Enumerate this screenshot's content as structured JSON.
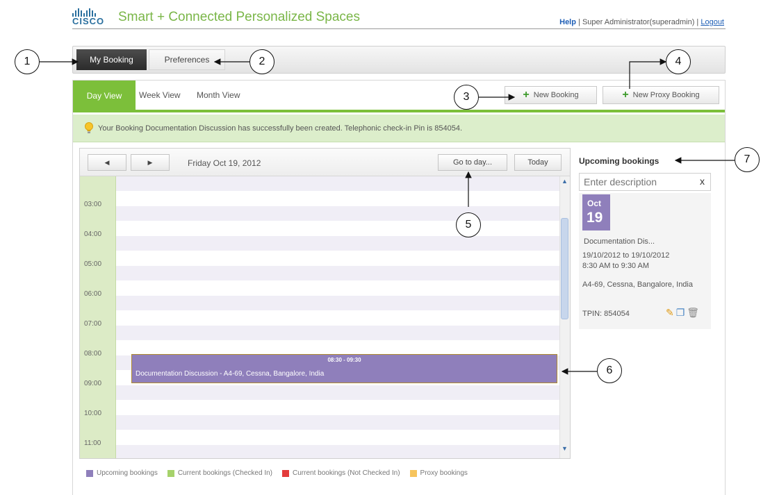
{
  "header": {
    "logo_text": "CISCO",
    "app_title": "Smart + Connected Personalized Spaces",
    "help": "Help",
    "separator": " | ",
    "user": "Super Administrator(superadmin)",
    "separator2": " | ",
    "logout": "Logout"
  },
  "top_tabs": {
    "my_booking": "My Booking",
    "preferences": "Preferences"
  },
  "view_tabs": {
    "day": "Day View",
    "week": "Week View",
    "month": "Month View"
  },
  "actions": {
    "new_booking": "New Booking",
    "new_proxy_booking": "New Proxy Booking"
  },
  "notice": "Your Booking Documentation Discussion has successfully been created. Telephonic check-in Pin is 854054.",
  "calendar": {
    "prev": "◀",
    "next": "▶",
    "date_label": "Friday Oct 19, 2012",
    "goto_day": "Go to day...",
    "today": "Today",
    "hours": [
      "03:00",
      "04:00",
      "05:00",
      "06:00",
      "07:00",
      "08:00",
      "09:00",
      "10:00",
      "11:00"
    ],
    "event": {
      "time": "08:30 - 09:30",
      "title": "Documentation Discussion - A4-69, Cessna, Bangalore, India",
      "color": "#8f7fbb"
    }
  },
  "legend": [
    {
      "label": "Upcoming bookings",
      "color": "#8f7fbb"
    },
    {
      "label": "Current bookings (Checked In)",
      "color": "#a6d26b"
    },
    {
      "label": "Current bookings (Not Checked In)",
      "color": "#e33b3b"
    },
    {
      "label": "Proxy bookings",
      "color": "#f6c45d"
    }
  ],
  "upcoming": {
    "title": "Upcoming bookings",
    "search_placeholder": "Enter description",
    "clear": "x",
    "card": {
      "month": "Oct",
      "day": "19",
      "title": "Documentation Dis...",
      "range": "19/10/2012 to 19/10/2012",
      "time": "8:30 AM to 9:30 AM",
      "location": "A4-69, Cessna, Bangalore, India",
      "tpin": "TPIN: 854054"
    }
  },
  "callouts": [
    "1",
    "2",
    "3",
    "4",
    "5",
    "6",
    "7"
  ],
  "icons": {
    "edit": "pencil-icon",
    "copy": "copy-icon",
    "delete": "trash-icon",
    "tip": "lightbulb-icon"
  }
}
